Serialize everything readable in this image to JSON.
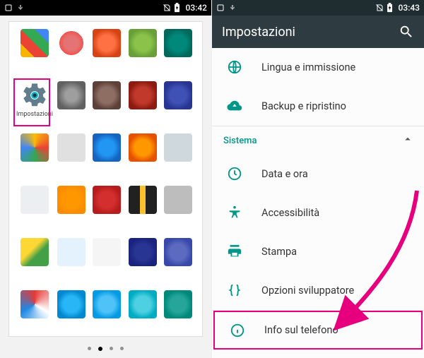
{
  "left": {
    "status_time": "03:42",
    "settings_app_label": "Impostazioni"
  },
  "right": {
    "status_time": "03:43",
    "toolbar_title": "Impostazioni",
    "section_system": "Sistema",
    "items": {
      "language": "Lingua e immissione",
      "backup": "Backup e ripristino",
      "date": "Data e ora",
      "accessibility": "Accessibilità",
      "print": "Stampa",
      "developer": "Opzioni sviluppatore",
      "about": "Info sul telefono"
    }
  },
  "colors": {
    "teal": "#009688",
    "magenta": "#e6007e"
  }
}
